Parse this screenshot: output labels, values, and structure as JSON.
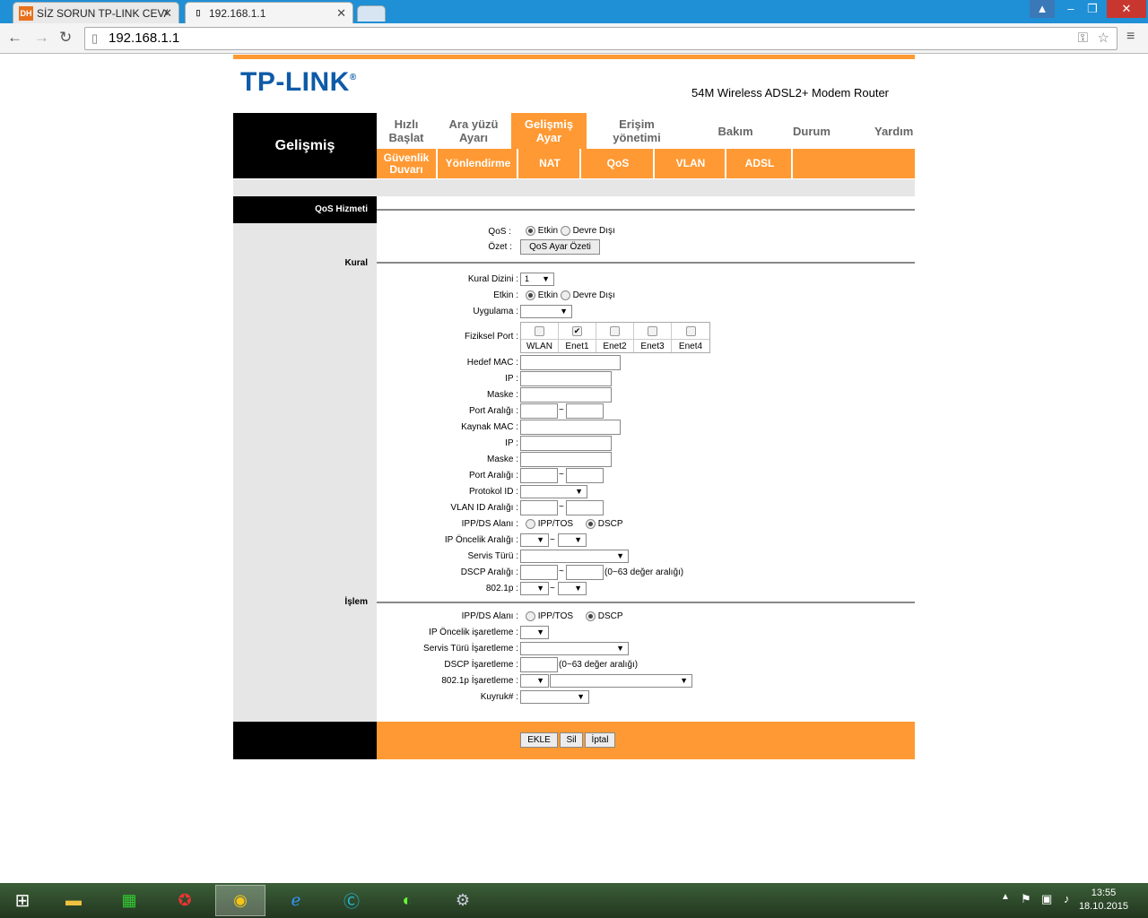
{
  "browser": {
    "tabs": [
      {
        "title": "SİZ SORUN TP-LINK CEVA",
        "favicon": "DH"
      },
      {
        "title": "192.168.1.1"
      }
    ],
    "url": "192.168.1.1"
  },
  "router": {
    "brand": "TP-LINK",
    "trademark": "®",
    "model": "54M Wireless ADSL2+ Modem Router",
    "section_title": "Gelişmiş",
    "main_tabs": [
      {
        "line1": "Hızlı",
        "line2": "Başlat"
      },
      {
        "line1": "Ara yüzü",
        "line2": "Ayarı"
      },
      {
        "line1": "Gelişmiş",
        "line2": "Ayar"
      },
      {
        "line1": "Erişim",
        "line2": "yönetimi"
      },
      {
        "line1": "Bakım",
        "line2": ""
      },
      {
        "line1": "Durum",
        "line2": ""
      },
      {
        "line1": "Yardım",
        "line2": ""
      }
    ],
    "sub_tabs": [
      {
        "line1": "Güvenlik",
        "line2": "Duvarı"
      },
      {
        "line1": "Yönlendirme",
        "line2": ""
      },
      {
        "line1": "NAT",
        "line2": ""
      },
      {
        "line1": "QoS",
        "line2": ""
      },
      {
        "line1": "VLAN",
        "line2": ""
      },
      {
        "line1": "ADSL",
        "line2": ""
      }
    ],
    "qos_header": "QoS Hizmeti"
  },
  "qos": {
    "qos_label": "QoS",
    "enable": "Etkin",
    "disable": "Devre Dışı",
    "summary_label": "Özet",
    "summary_button": "QoS Ayar Özeti"
  },
  "rule": {
    "section": "Kural",
    "index_label": "Kural Dizini",
    "index_value": "1",
    "active_label": "Etkin",
    "app_label": "Uygulama",
    "phys_port_label": "Fiziksel Port",
    "ports": [
      "WLAN",
      "Enet1",
      "Enet2",
      "Enet3",
      "Enet4"
    ],
    "port_checked": [
      false,
      true,
      false,
      false,
      false
    ],
    "dest_mac": "Hedef MAC",
    "ip": "IP",
    "mask": "Maske",
    "port_range": "Port Aralığı",
    "src_mac": "Kaynak MAC",
    "protocol_id": "Protokol ID",
    "vlan_range": "VLAN ID Aralığı",
    "ippds_label": "IPP/DS Alanı",
    "ipp_tos": "IPP/TOS",
    "dscp": "DSCP",
    "ip_prec_range": "IP Öncelik Aralığı",
    "service_type": "Servis Türü",
    "dscp_range": "DSCP Aralığı",
    "dscp_hint": "(0~63 değer aralığı)",
    "p8021": "802.1p",
    "tilde": "~"
  },
  "action": {
    "section": "İşlem",
    "ippds_label": "IPP/DS Alanı",
    "ip_prec_mark": "IP Öncelik işaretleme",
    "service_mark": "Servis Türü İşaretleme",
    "dscp_mark": "DSCP İşaretleme",
    "dscp_hint": "(0~63 değer aralığı)",
    "p8021_mark": "802.1p İşaretleme",
    "queue": "Kuyruk#"
  },
  "buttons": {
    "add": "EKLE",
    "delete": "Sil",
    "cancel": "İptal"
  },
  "taskbar": {
    "time": "13:55",
    "date": "18.10.2015"
  }
}
